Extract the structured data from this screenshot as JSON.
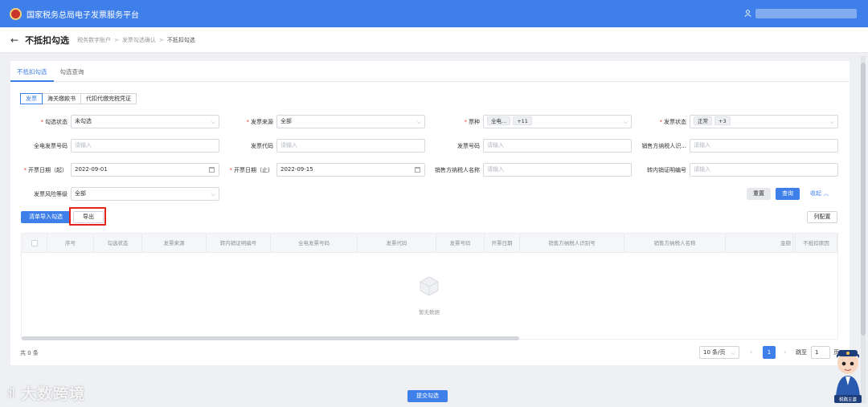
{
  "app": {
    "title": "国家税务总局电子发票服务平台"
  },
  "header": {
    "page_title": "不抵扣勾选",
    "breadcrumb": [
      "税务数字账户",
      "发票勾选确认",
      "不抵扣勾选"
    ]
  },
  "tabs": [
    "不抵扣勾选",
    "勾选查询"
  ],
  "doc_types": [
    "发票",
    "海关缴款书",
    "代扣代缴完税凭证"
  ],
  "filters": {
    "check_status": {
      "label": "勾选状态",
      "value": "未勾选"
    },
    "invoice_source": {
      "label": "发票来源",
      "value": "全部"
    },
    "ticket_type": {
      "label": "票种",
      "tag": "全电...",
      "more": "+11"
    },
    "invoice_status": {
      "label": "发票状态",
      "tag": "正常",
      "more": "+3"
    },
    "full_invoice_no": {
      "label": "全电发票号码",
      "placeholder": "请输入"
    },
    "invoice_code": {
      "label": "发票代码",
      "placeholder": "请输入"
    },
    "invoice_no": {
      "label": "发票号码",
      "placeholder": "请输入"
    },
    "seller_tax_id": {
      "label": "销售方纳税人识...",
      "placeholder": "请输入"
    },
    "date_start": {
      "label": "开票日期（起）",
      "value": "2022-09-01"
    },
    "date_end": {
      "label": "开票日期（止）",
      "value": "2022-09-15"
    },
    "seller_name": {
      "label": "销售方纳税人名称",
      "placeholder": "请输入"
    },
    "transfer_no": {
      "label": "转内销证明编号",
      "placeholder": "请输入"
    },
    "risk_level": {
      "label": "发票风险等级",
      "value": "全部"
    }
  },
  "actions": {
    "reset": "重置",
    "query": "查询",
    "collapse": "收起",
    "import_check": "清单导入勾选",
    "export": "导出",
    "column_config": "列配置",
    "submit": "提交勾选"
  },
  "table": {
    "columns": [
      "序号",
      "勾选状态",
      "发票来源",
      "转内销证明编号",
      "全电发票号码",
      "发票代码",
      "发票号码",
      "开票日期",
      "销售方纳税人识别号",
      "销售方纳税人名称",
      "金额",
      "不抵扣原因"
    ],
    "empty": "暂无数据"
  },
  "pagination": {
    "total": "共 0 条",
    "page_size": "10 条/页",
    "current": "1",
    "goto_label": "跳至",
    "goto_value": "1",
    "goto_unit": "页"
  },
  "watermark": "大数跨境",
  "mascot": {
    "badge": "税務王婆"
  },
  "colors": {
    "primary": "#3f7fe9",
    "highlight": "#e2231a",
    "required": "#e64a3b"
  }
}
